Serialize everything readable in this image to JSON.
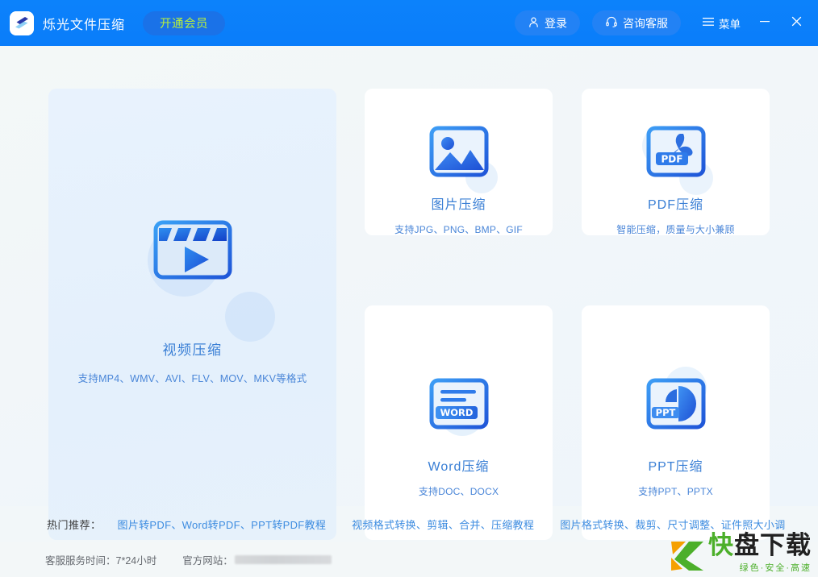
{
  "titlebar": {
    "app_name": "烁光文件压缩",
    "logo_icon": "app-logo-icon",
    "vip_button": "开通会员",
    "login": {
      "label": "登录",
      "icon": "user-icon"
    },
    "service": {
      "label": "咨询客服",
      "icon": "headset-icon"
    },
    "menu": {
      "label": "菜单",
      "icon": "hamburger-icon"
    },
    "minimize_icon": "minimize-icon",
    "close_icon": "close-icon",
    "colors": {
      "bar": "#0a7dfa",
      "pill": "#2282f5",
      "vip_text": "#b9f03a"
    }
  },
  "cards": {
    "video": {
      "title": "视频压缩",
      "subtitle": "支持MP4、WMV、AVI、FLV、MOV、MKV等格式",
      "icon": "video-player-icon"
    },
    "image": {
      "title": "图片压缩",
      "subtitle": "支持JPG、PNG、BMP、GIF",
      "icon": "picture-icon"
    },
    "pdf": {
      "title": "PDF压缩",
      "subtitle": "智能压缩，质量与大小兼顾",
      "icon": "pdf-file-icon"
    },
    "word": {
      "title": "Word压缩",
      "subtitle": "支持DOC、DOCX",
      "icon": "word-file-icon",
      "badge": "WORD"
    },
    "ppt": {
      "title": "PPT压缩",
      "subtitle": "支持PPT、PPTX",
      "icon": "ppt-file-icon",
      "badge": "PPT"
    }
  },
  "recommend": {
    "label": "热门推荐：",
    "links": [
      "图片转PDF、Word转PDF、PPT转PDF教程",
      "视频格式转换、剪辑、合并、压缩教程",
      "图片格式转换、裁剪、尺寸调整、证件照大小调"
    ]
  },
  "footer": {
    "service_hours": "客服服务时间：7*24小时",
    "website_label": "官方网站："
  },
  "watermark": {
    "name_green": "快",
    "name_dark": "盘下载",
    "slogan": "绿色·安全·高速",
    "logo_icon": "kuaipan-k-icon"
  }
}
